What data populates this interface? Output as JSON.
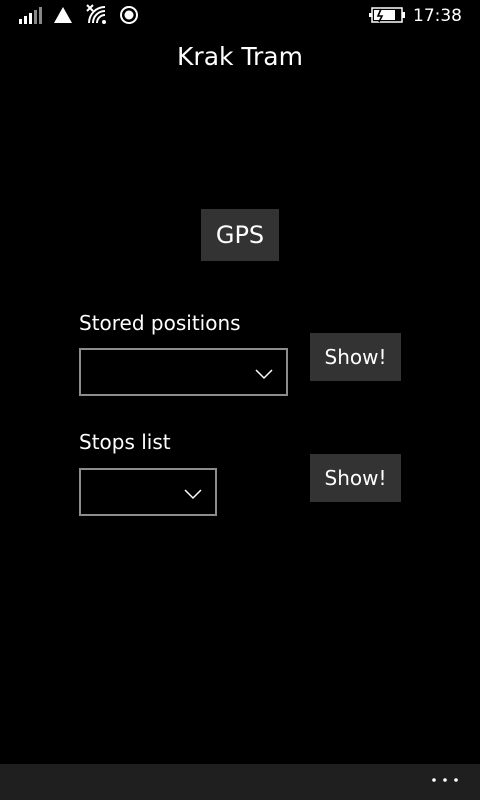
{
  "status_bar": {
    "time": "17:38",
    "icons": [
      "signal-strength-icon",
      "network-triangle-icon",
      "wifi-icon",
      "location-icon",
      "battery-charging-icon"
    ]
  },
  "app": {
    "title": "Krak Tram"
  },
  "main": {
    "gps_label": "GPS",
    "stored_positions": {
      "label": "Stored positions",
      "selected": "",
      "show_label": "Show!"
    },
    "stops_list": {
      "label": "Stops list",
      "selected": "",
      "show_label": "Show!"
    }
  },
  "app_bar": {
    "more_icon": "more-ellipsis-icon"
  }
}
